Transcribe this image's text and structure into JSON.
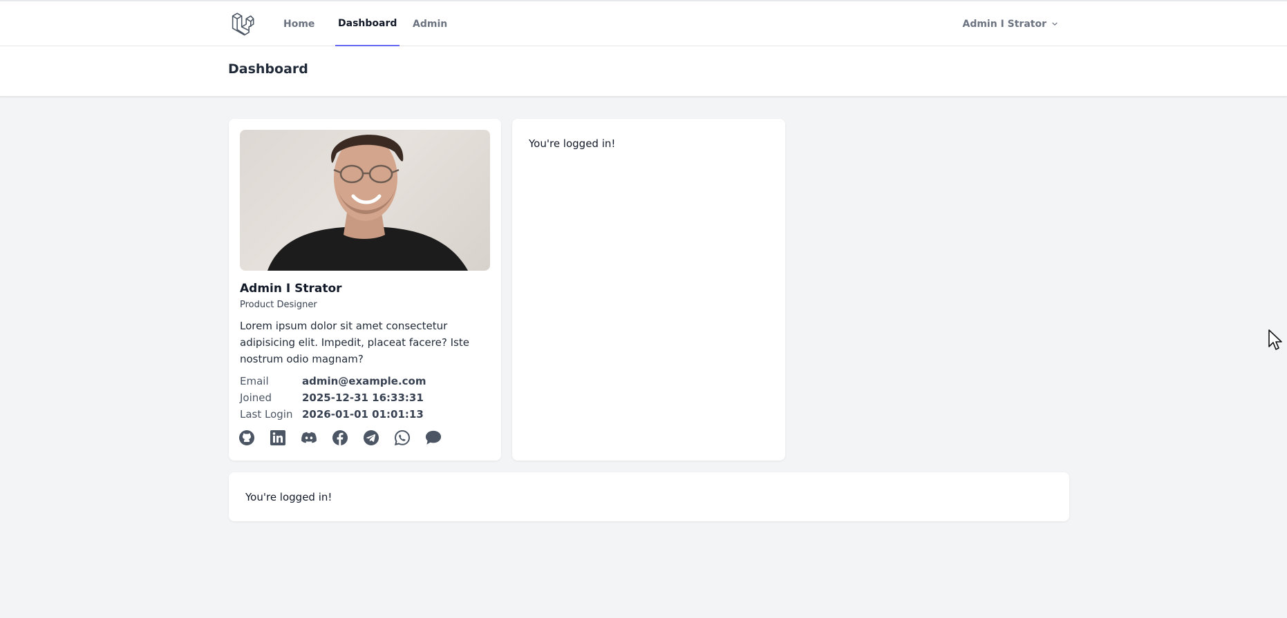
{
  "nav": {
    "links": [
      {
        "label": "Home"
      },
      {
        "label": "Dashboard"
      },
      {
        "label": "Admin"
      }
    ],
    "user_name": "Admin I Strator"
  },
  "header": {
    "title": "Dashboard"
  },
  "profile": {
    "name": "Admin I Strator",
    "role": "Product Designer",
    "bio": "Lorem ipsum dolor sit amet consectetur adipisicing elit. Impedit, placeat facere? Iste nostrum odio magnam?",
    "email_label": "Email",
    "email_value": "admin@example.com",
    "joined_label": "Joined",
    "joined_value": "2025-12-31 16:33:31",
    "last_login_label": "Last Login",
    "last_login_value": "2026-01-01 01:01:13",
    "socials": [
      "github-icon",
      "linkedin-icon",
      "discord-icon",
      "facebook-icon",
      "telegram-icon",
      "whatsapp-icon",
      "chat-icon"
    ]
  },
  "cards": {
    "side_message": "You're logged in!",
    "bottom_message": "You're logged in!"
  },
  "colors": {
    "accent": "#6366f1",
    "background": "#f3f4f6",
    "icon": "#4b5563"
  }
}
